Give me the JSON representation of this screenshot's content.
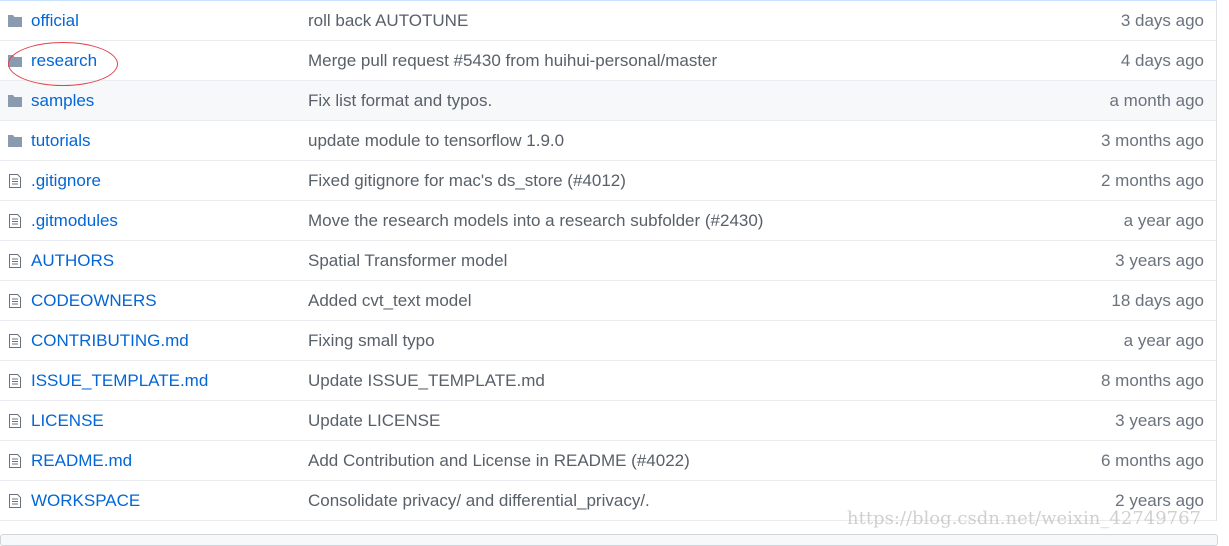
{
  "files": [
    {
      "type": "folder",
      "name": "official",
      "message": "roll back AUTOTUNE",
      "age": "3 days ago"
    },
    {
      "type": "folder",
      "name": "research",
      "message": "Merge pull request #5430 from huihui-personal/master",
      "age": "4 days ago",
      "highlighted": true
    },
    {
      "type": "folder",
      "name": "samples",
      "message": "Fix list format and typos.",
      "age": "a month ago",
      "hover": true
    },
    {
      "type": "folder",
      "name": "tutorials",
      "message": "update module to tensorflow 1.9.0",
      "age": "3 months ago"
    },
    {
      "type": "file",
      "name": ".gitignore",
      "message": "Fixed gitignore for mac's ds_store (#4012)",
      "age": "2 months ago"
    },
    {
      "type": "file",
      "name": ".gitmodules",
      "message": "Move the research models into a research subfolder (#2430)",
      "age": "a year ago"
    },
    {
      "type": "file",
      "name": "AUTHORS",
      "message": "Spatial Transformer model",
      "age": "3 years ago"
    },
    {
      "type": "file",
      "name": "CODEOWNERS",
      "message": "Added cvt_text model",
      "age": "18 days ago"
    },
    {
      "type": "file",
      "name": "CONTRIBUTING.md",
      "message": "Fixing small typo",
      "age": "a year ago"
    },
    {
      "type": "file",
      "name": "ISSUE_TEMPLATE.md",
      "message": "Update ISSUE_TEMPLATE.md",
      "age": "8 months ago"
    },
    {
      "type": "file",
      "name": "LICENSE",
      "message": "Update LICENSE",
      "age": "3 years ago"
    },
    {
      "type": "file",
      "name": "README.md",
      "message": "Add Contribution and License in README (#4022)",
      "age": "6 months ago"
    },
    {
      "type": "file",
      "name": "WORKSPACE",
      "message": "Consolidate privacy/ and differential_privacy/.",
      "age": "2 years ago"
    }
  ],
  "watermark": "https://blog.csdn.net/weixin_42749767",
  "colors": {
    "link": "#0366d6",
    "folder_icon": "#79b8ff",
    "annotation_circle": "#e0434a"
  }
}
